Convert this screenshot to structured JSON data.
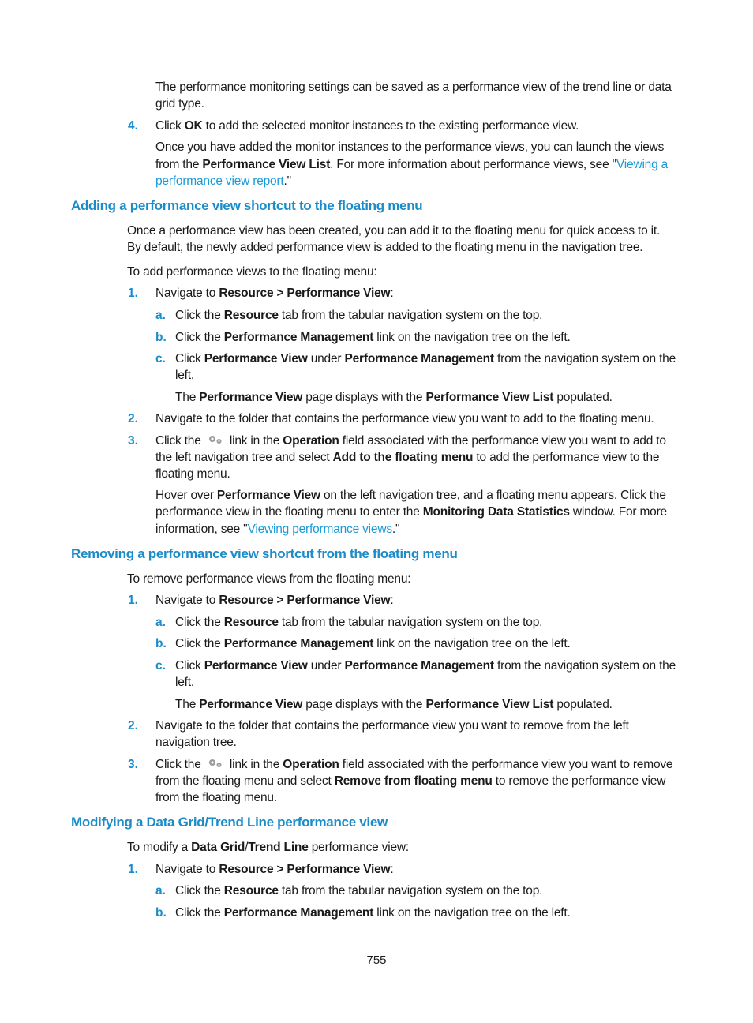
{
  "intro": {
    "para1_l1": "The performance monitoring settings can be saved as a performance view of the trend line or data",
    "para1_l2": "grid type.",
    "step4_num": "4.",
    "step4_pre": "Click ",
    "step4_b": "OK",
    "step4_post": " to add the selected monitor instances to the existing performance view.",
    "para2_l1": "Once you have added the monitor instances to the performance views, you can launch the views",
    "para2_l2_pre": "from the ",
    "para2_l2_b": "Performance View List",
    "para2_l2_mid": ". For more information about performance views, see \"",
    "para2_l2_link": "Viewing a",
    "para2_l3_link": "performance view report",
    "para2_l3_post": ".\""
  },
  "section1": {
    "heading": "Adding a performance view shortcut to the floating menu",
    "p1_l1": "Once a performance view has been created, you can add it to the floating menu for quick access to it.",
    "p1_l2": "By default, the newly added performance view is added to the floating menu in the navigation tree.",
    "p2": "To add performance views to the floating menu:",
    "s1_num": "1.",
    "s1_pre": "Navigate to ",
    "s1_b": "Resource > Performance View",
    "s1_post": ":",
    "a_num": "a.",
    "a_pre": "Click the ",
    "a_b": "Resource",
    "a_post": " tab from the tabular navigation system on the top.",
    "b_num": "b.",
    "b_pre": "Click the ",
    "b_b": "Performance Management",
    "b_post": " link on the navigation tree on the left.",
    "c_num": "c.",
    "c_pre": "Click ",
    "c_b1": "Performance View",
    "c_mid": " under ",
    "c_b2": "Performance Management",
    "c_post": " from the navigation system on the",
    "c_l2": "left.",
    "c_res_pre": "The ",
    "c_res_b1": "Performance View",
    "c_res_mid": " page displays with the ",
    "c_res_b2": "Performance View List",
    "c_res_post": " populated.",
    "s2_num": "2.",
    "s2": "Navigate to the folder that contains the performance view you want to add to the floating menu.",
    "s3_num": "3.",
    "s3_pre": "Click the ",
    "s3_mid1": " link in the ",
    "s3_b1": "Operation",
    "s3_post1": " field associated with the performance view you want to add to",
    "s3_l2_pre": "the left navigation tree and select ",
    "s3_l2_b": "Add to the floating menu",
    "s3_l2_post": " to add the performance view to the",
    "s3_l3": "floating menu.",
    "hover_l1_pre": "Hover over ",
    "hover_l1_b": "Performance View",
    "hover_l1_post": " on the left navigation tree, and a floating menu appears. Click the",
    "hover_l2_pre": "performance view in the floating menu to enter the ",
    "hover_l2_b": "Monitoring Data Statistics",
    "hover_l2_post": " window. For more",
    "hover_l3_pre": "information, see \"",
    "hover_l3_link": "Viewing performance views",
    "hover_l3_post": ".\""
  },
  "section2": {
    "heading": "Removing a performance view shortcut from the floating menu",
    "p1": "To remove performance views from the floating menu:",
    "s1_num": "1.",
    "s1_pre": "Navigate to ",
    "s1_b": "Resource > Performance View",
    "s1_post": ":",
    "a_num": "a.",
    "a_pre": "Click the ",
    "a_b": "Resource",
    "a_post": " tab from the tabular navigation system on the top.",
    "b_num": "b.",
    "b_pre": "Click the ",
    "b_b": "Performance Management",
    "b_post": " link on the navigation tree on the left.",
    "c_num": "c.",
    "c_pre": "Click ",
    "c_b1": "Performance View",
    "c_mid": " under ",
    "c_b2": "Performance Management",
    "c_post": " from the navigation system on the",
    "c_l2": "left.",
    "c_res_pre": "The ",
    "c_res_b1": "Performance View",
    "c_res_mid": " page displays with the ",
    "c_res_b2": "Performance View List",
    "c_res_post": " populated.",
    "s2_num": "2.",
    "s2_l1": "Navigate to the folder that contains the performance view you want to remove from the left",
    "s2_l2": "navigation tree.",
    "s3_num": "3.",
    "s3_pre": "Click the ",
    "s3_mid1": " link in the ",
    "s3_b1": "Operation",
    "s3_post1": " field associated with the performance view you want to remove",
    "s3_l2_pre": "from the floating menu and select ",
    "s3_l2_b": "Remove from floating menu",
    "s3_l2_post": " to remove the performance view",
    "s3_l3": "from the floating menu."
  },
  "section3": {
    "heading": "Modifying a Data Grid/Trend Line performance view",
    "p1_pre": "To modify a ",
    "p1_b1": "Data Grid",
    "p1_slash": "/",
    "p1_b2": "Trend Line",
    "p1_post": " performance view:",
    "s1_num": "1.",
    "s1_pre": "Navigate to ",
    "s1_b": "Resource > Performance View",
    "s1_post": ":",
    "a_num": "a.",
    "a_pre": "Click the ",
    "a_b": "Resource",
    "a_post": " tab from the tabular navigation system on the top.",
    "b_num": "b.",
    "b_pre": "Click the ",
    "b_b": "Performance Management",
    "b_post": " link on the navigation tree on the left."
  },
  "footer": {
    "page_number": "755"
  },
  "colors": {
    "accent": "#1a8cc9",
    "link": "#1a9ad6",
    "text": "#1a1a1a"
  }
}
